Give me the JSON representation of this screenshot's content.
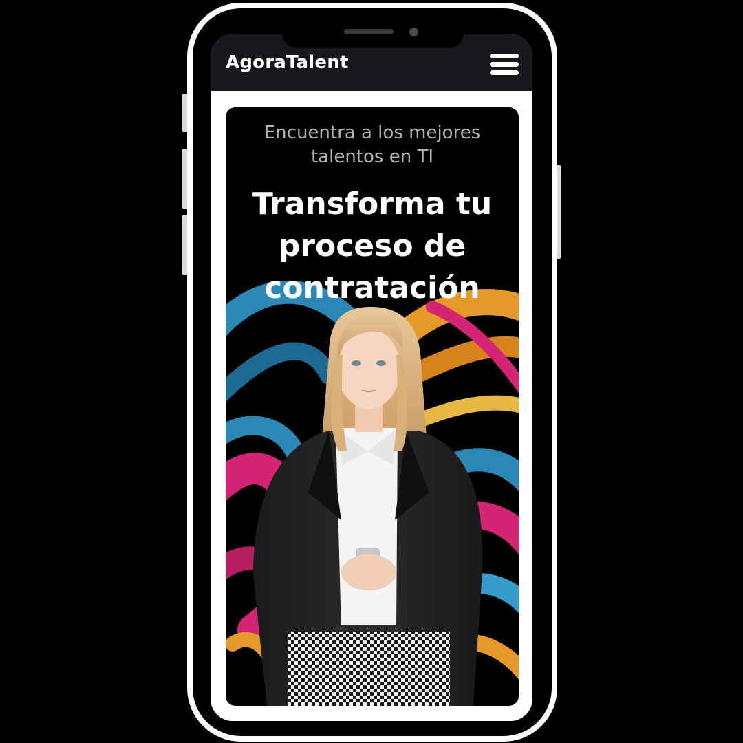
{
  "header": {
    "brand": "AgoraTalent",
    "menu_icon": "hamburger-menu-icon"
  },
  "hero": {
    "subtitle": "Encuentra a los mejores talentos en TI",
    "title": "Transforma tu proceso de contratación",
    "image": "woman-in-blazer-holding-phone-on-abstract-paint-strokes"
  },
  "colors": {
    "navbar_bg": "#16181b",
    "hero_bg": "#000000",
    "subtitle_text": "#b3b3b3",
    "title_text": "#ffffff",
    "paint_pink": "#e0267a",
    "paint_blue": "#2e8fc0",
    "paint_orange": "#f2a22c"
  }
}
